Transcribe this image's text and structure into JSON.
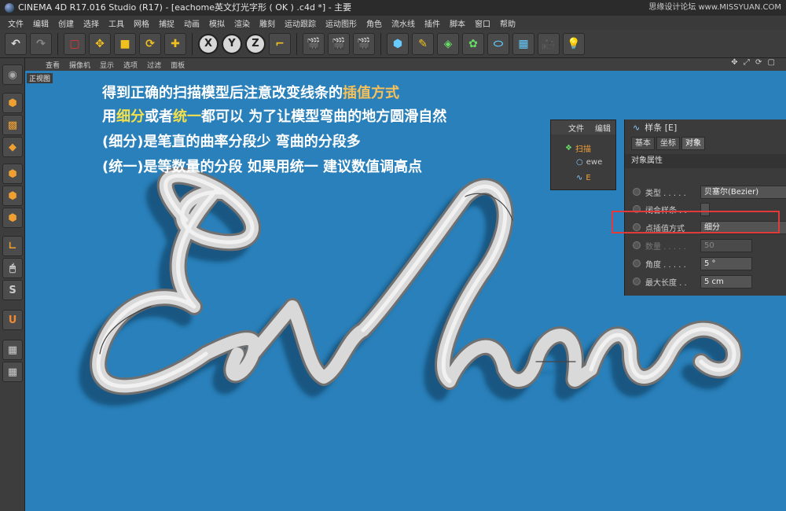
{
  "titlebar": {
    "title": "CINEMA 4D R17.016 Studio (R17) - [eachome英文灯光字形 ( OK ) .c4d *] - 主要",
    "watermark": "思缘设计论坛 www.MISSYUAN.COM"
  },
  "menu": [
    "文件",
    "编辑",
    "创建",
    "选择",
    "工具",
    "网格",
    "捕捉",
    "动画",
    "模拟",
    "渲染",
    "雕刻",
    "运动跟踪",
    "运动图形",
    "角色",
    "流水线",
    "插件",
    "脚本",
    "窗口",
    "帮助"
  ],
  "toolbar": {
    "undo": "↶",
    "redo": "↷",
    "axis_x": "X",
    "axis_y": "Y",
    "axis_z": "Z"
  },
  "viewport_menu": [
    "查看",
    "摄像机",
    "显示",
    "选项",
    "过滤",
    "面板"
  ],
  "viewport_label": "正视图",
  "tutorial": {
    "line1_a": "得到正确的扫描模型后注意改变线条的",
    "line1_b": "插值方式",
    "line2_a": "用",
    "line2_b": "细分",
    "line2_c": "或者",
    "line2_d": "统一",
    "line2_e": "都可以   为了让模型弯曲的地方圆滑自然",
    "line3": "(细分)是笔直的曲率分段少  弯曲的分段多",
    "line4": "(统一)是等数量的分段  如果用统一 建议数值调高点"
  },
  "object_manager": {
    "menu_file": "文件",
    "menu_edit": "编辑",
    "items": [
      "扫描",
      "ewe",
      "E"
    ]
  },
  "attributes": {
    "title": "样条 [E]",
    "tabs": [
      "基本",
      "坐标",
      "对象"
    ],
    "active_tab": "对象",
    "section": "对象属性",
    "rows": [
      {
        "label": "类型 . . . . .",
        "value": "贝塞尔(Bezier)"
      },
      {
        "label": "闭合样条 . .",
        "value": ""
      },
      {
        "label": "点插值方式",
        "value": "细分"
      },
      {
        "label": "数量 . . . . .",
        "value": "50"
      },
      {
        "label": "角度 . . . . .",
        "value": "5 °"
      },
      {
        "label": "最大长度 . .",
        "value": "5 cm"
      }
    ]
  },
  "model_text": "Eachome",
  "colors": {
    "viewport": "#2a80ba",
    "highlight": "#e23a3a",
    "tube": "#d9d9d9"
  }
}
